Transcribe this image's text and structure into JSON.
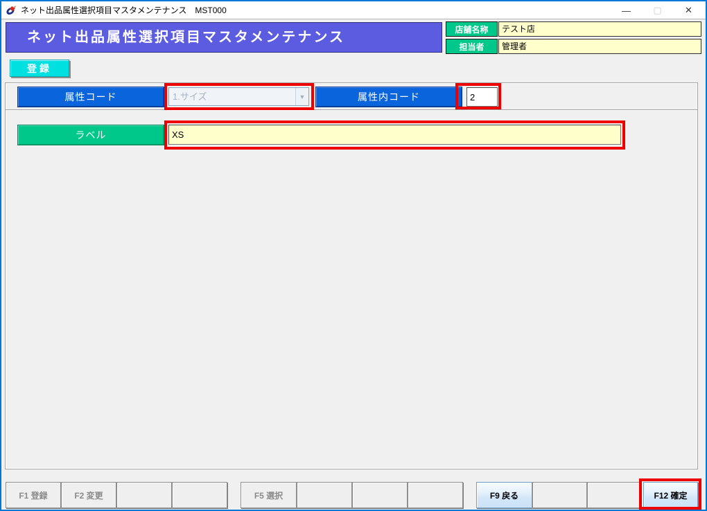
{
  "window": {
    "title": "ネット出品属性選択項目マスタメンテナンス　MST000",
    "minimize_glyph": "—",
    "maximize_glyph": "▢",
    "close_glyph": "✕"
  },
  "header": {
    "banner_title": "ネット出品属性選択項目マスタメンテナンス",
    "shop_label": "店舗名称",
    "shop_value": "テスト店",
    "staff_label": "担当者",
    "staff_value": "管理者"
  },
  "mode": {
    "register_label": "登録"
  },
  "form": {
    "attr_code_label": "属性コード",
    "attr_code_value": "1.サイズ",
    "attr_code_dropdown_glyph": "▼",
    "attr_inner_code_label": "属性内コード",
    "attr_inner_code_value": "2",
    "label_label": "ラベル",
    "label_value": "XS"
  },
  "function_keys": [
    {
      "key": "F1",
      "label": "F1 登録",
      "state": "disabled"
    },
    {
      "key": "F2",
      "label": "F2 変更",
      "state": "disabled"
    },
    {
      "key": "F3",
      "label": "",
      "state": "empty"
    },
    {
      "key": "F4",
      "label": "",
      "state": "empty"
    },
    {
      "key": "F5",
      "label": "F5 選択",
      "state": "disabled"
    },
    {
      "key": "F6",
      "label": "",
      "state": "empty"
    },
    {
      "key": "F7",
      "label": "",
      "state": "empty"
    },
    {
      "key": "F8",
      "label": "",
      "state": "empty"
    },
    {
      "key": "F9",
      "label": "F9 戻る",
      "state": "enabled"
    },
    {
      "key": "F10",
      "label": "",
      "state": "empty"
    },
    {
      "key": "F11",
      "label": "",
      "state": "empty"
    },
    {
      "key": "F12",
      "label": "F12 確定",
      "state": "enabled",
      "highlighted": true
    }
  ],
  "colors": {
    "window_border": "#0078d7",
    "client_bg": "#f0f0f0",
    "banner_bg": "#5c5ce0",
    "label_blue": "#0a64dc",
    "label_green": "#00c88a",
    "field_yellow": "#ffffcc",
    "register_cyan": "#00e0e0",
    "annotation_red": "#ee0000"
  }
}
